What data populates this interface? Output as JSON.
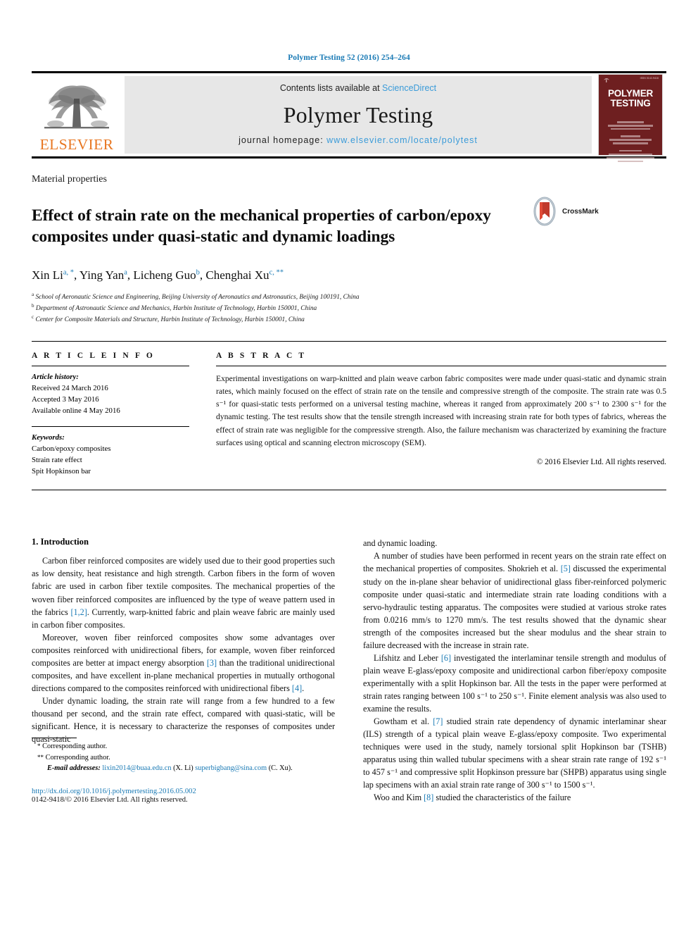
{
  "running_head": "Polymer Testing 52 (2016) 254–264",
  "masthead": {
    "publisher_name": "ELSEVIER",
    "contents_prefix": "Contents lists available at ",
    "contents_link": "ScienceDirect",
    "journal_title": "Polymer Testing",
    "homepage_prefix": "journal homepage: ",
    "homepage_url": "www.elsevier.com/locate/polytest",
    "cover_title_line1": "POLYMER",
    "cover_title_line2": "TESTING"
  },
  "section_label": "Material properties",
  "title": "Effect of strain rate on the mechanical properties of carbon/epoxy composites under quasi-static and dynamic loadings",
  "crossmark_label": "CrossMark",
  "authors": [
    {
      "name": "Xin Li",
      "marks": "a, *"
    },
    {
      "name": "Ying Yan",
      "marks": "a"
    },
    {
      "name": "Licheng Guo",
      "marks": "b"
    },
    {
      "name": "Chenghai Xu",
      "marks": "c, **"
    }
  ],
  "affiliations": [
    {
      "mark": "a",
      "text": "School of Aeronautic Science and Engineering, Beijing University of Aeronautics and Astronautics, Beijing 100191, China"
    },
    {
      "mark": "b",
      "text": "Department of Astronautic Science and Mechanics, Harbin Institute of Technology, Harbin 150001, China"
    },
    {
      "mark": "c",
      "text": "Center for Composite Materials and Structure, Harbin Institute of Technology, Harbin 150001, China"
    }
  ],
  "article_info": {
    "heading": "A R T I C L E  I N F O",
    "history_label": "Article history:",
    "history": [
      "Received 24 March 2016",
      "Accepted 3 May 2016",
      "Available online 4 May 2016"
    ],
    "keywords_label": "Keywords:",
    "keywords": [
      "Carbon/epoxy composites",
      "Strain rate effect",
      "Spit Hopkinson bar"
    ]
  },
  "abstract": {
    "heading": "A B S T R A C T",
    "text": "Experimental investigations on warp-knitted and plain weave carbon fabric composites were made under quasi-static and dynamic strain rates, which mainly focused on the effect of strain rate on the tensile and compressive strength of the composite. The strain rate was 0.5 s⁻¹ for quasi-static tests performed on a universal testing machine, whereas it ranged from approximately 200 s⁻¹ to 2300 s⁻¹ for the dynamic testing. The test results show that the tensile strength increased with increasing strain rate for both types of fabrics, whereas the effect of strain rate was negligible for the compressive strength. Also, the failure mechanism was characterized by examining the fracture surfaces using optical and scanning electron microscopy (SEM).",
    "copyright": "© 2016 Elsevier Ltd. All rights reserved."
  },
  "body": {
    "intro_heading": "1. Introduction",
    "left_paragraphs": [
      "Carbon fiber reinforced composites are widely used due to their good properties such as low density, heat resistance and high strength. Carbon fibers in the form of woven fabric are used in carbon fiber textile composites. The mechanical properties of the woven fiber reinforced composites are influenced by the type of weave pattern used in the fabrics [1,2]. Currently, warp-knitted fabric and plain weave fabric are mainly used in carbon fiber composites.",
      "Moreover, woven fiber reinforced composites show some advantages over composites reinforced with unidirectional fibers, for example, woven fiber reinforced composites are better at impact energy absorption [3] than the traditional unidirectional composites, and have excellent in-plane mechanical properties in mutually orthogonal directions compared to the composites reinforced with unidirectional fibers [4].",
      "Under dynamic loading, the strain rate will range from a few hundred to a few thousand per second, and the strain rate effect, compared with quasi-static, will be significant. Hence, it is necessary to characterize the responses of composites under quasi-static"
    ],
    "right_paragraphs": [
      "and dynamic loading.",
      "A number of studies have been performed in recent years on the strain rate effect on the mechanical properties of composites. Shokrieh et al. [5] discussed the experimental study on the in-plane shear behavior of unidirectional glass fiber-reinforced polymeric composite under quasi-static and intermediate strain rate loading conditions with a servo-hydraulic testing apparatus. The composites were studied at various stroke rates from 0.0216 mm/s to 1270 mm/s. The test results showed that the dynamic shear strength of the composites increased but the shear modulus and the shear strain to failure decreased with the increase in strain rate.",
      "Lifshitz and Leber [6] investigated the interlaminar tensile strength and modulus of plain weave E-glass/epoxy composite and unidirectional carbon fiber/epoxy composite experimentally with a split Hopkinson bar. All the tests in the paper were performed at strain rates ranging between 100 s⁻¹ to 250 s⁻¹. Finite element analysis was also used to examine the results.",
      "Gowtham et al. [7] studied strain rate dependency of dynamic interlaminar shear (ILS) strength of a typical plain weave E-glass/epoxy composite. Two experimental techniques were used in the study, namely torsional split Hopkinson bar (TSHB) apparatus using thin walled tubular specimens with a shear strain rate range of 192 s⁻¹ to 457 s⁻¹ and compressive split Hopkinson pressure bar (SHPB) apparatus using single lap specimens with an axial strain rate range of 300 s⁻¹ to 1500 s⁻¹.",
      "Woo and Kim [8] studied the characteristics of the failure"
    ]
  },
  "footnotes": {
    "corresponding_1_mark": "*",
    "corresponding_1": "Corresponding author.",
    "corresponding_2_mark": "**",
    "corresponding_2": "Corresponding author.",
    "email_label": "E-mail addresses:",
    "email_1": "lixin2014@buaa.edu.cn",
    "email_1_owner": "(X. Li)",
    "email_2": "superbigbang@sina.com",
    "email_2_owner": "(C. Xu).",
    "doi": "http://dx.doi.org/10.1016/j.polymertesting.2016.05.002",
    "issn_line": "0142-9418/© 2016 Elsevier Ltd. All rights reserved."
  },
  "colors": {
    "link_blue": "#1a7ab5",
    "sciencedirect_blue": "#3a9bd9",
    "elsevier_orange": "#E87722",
    "cover_maroon": "#6e1f20",
    "masthead_gray": "#e7e7e7"
  }
}
